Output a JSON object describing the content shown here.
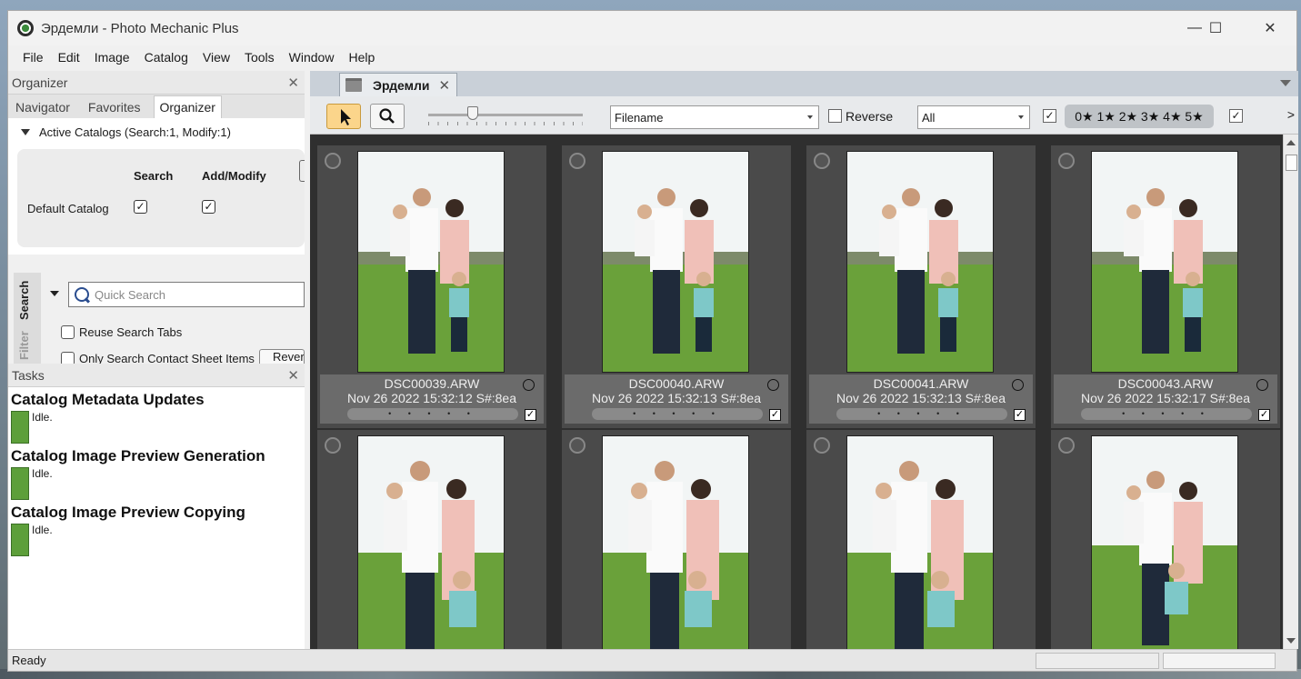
{
  "window": {
    "title": "Эрдемли - Photo Mechanic Plus"
  },
  "menu": [
    "File",
    "Edit",
    "Image",
    "Catalog",
    "View",
    "Tools",
    "Window",
    "Help"
  ],
  "organizer": {
    "header": "Organizer",
    "tabs": [
      "Navigator",
      "Favorites",
      "Organizer"
    ],
    "active_catalogs": "Active Catalogs (Search:1, Modify:1)",
    "col_search": "Search",
    "col_add_modify": "Add/Modify",
    "catalog_name": "Default Catalog",
    "vtab_search": "Search",
    "vtab_filter": "Filter",
    "quick_search_placeholder": "Quick Search",
    "reuse_search_tabs": "Reuse Search Tabs",
    "only_contact_sheet": "Only Search Contact Sheet Items",
    "reverse_btn": "Rever"
  },
  "tasks": {
    "header": "Tasks",
    "items": [
      {
        "title": "Catalog Metadata Updates",
        "status": "Idle."
      },
      {
        "title": "Catalog Image Preview Generation",
        "status": "Idle."
      },
      {
        "title": "Catalog Image Preview Copying",
        "status": "Idle."
      }
    ]
  },
  "contact_sheet": {
    "tab_label": "Эрдемли",
    "sort_by": "Filename",
    "reverse_label": "Reverse",
    "filter": "All",
    "stars": "0★ 1★ 2★ 3★ 4★ 5★",
    "more": ">",
    "thumbnails": [
      {
        "name": "DSC00039.ARW",
        "info": "Nov 26 2022 15:32:12 S#:8ea"
      },
      {
        "name": "DSC00040.ARW",
        "info": "Nov 26 2022 15:32:13 S#:8ea"
      },
      {
        "name": "DSC00041.ARW",
        "info": "Nov 26 2022 15:32:13 S#:8ea"
      },
      {
        "name": "DSC00043.ARW",
        "info": "Nov 26 2022 15:32:17 S#:8ea"
      }
    ],
    "dots": "• • • • •"
  },
  "status": {
    "text": "Ready"
  },
  "colors": {
    "accent_tool": "#fbd58b",
    "task_bar": "#5d9f3a",
    "grid_bg": "#2f2f2f"
  }
}
